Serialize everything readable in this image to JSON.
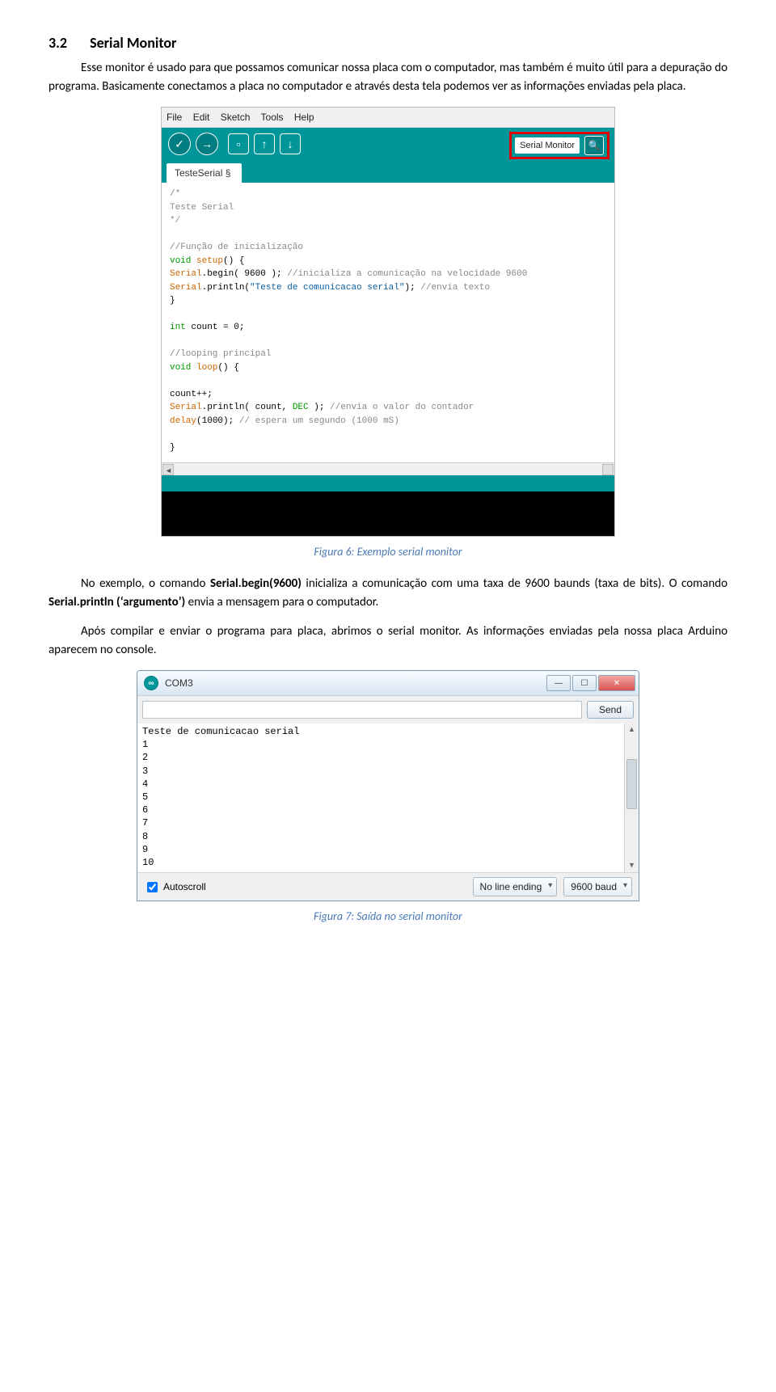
{
  "doc": {
    "heading_num": "3.2",
    "heading_title": "Serial Monitor",
    "p1": "Esse monitor é usado para que possamos comunicar nossa placa com o computador, mas também é muito útil para a depuração do programa. Basicamente conectamos a placa no computador e através desta tela podemos ver as informações enviadas pela placa.",
    "caption1": "Figura 6: Exemplo serial monitor",
    "p2_pre": "No exemplo, o comando ",
    "p2_b1": "Serial.begin(9600)",
    "p2_mid": " inicializa a comunicação com uma taxa de 9600 baunds (taxa de bits). O comando ",
    "p2_b2": "Serial.println (‘argumento’)",
    "p2_post": " envia a mensagem para o computador.",
    "p3": "Após compilar e enviar o programa para placa, abrimos o serial monitor. As informações enviadas pela nossa placa Arduino aparecem no console.",
    "caption2": "Figura 7: Saída no serial monitor"
  },
  "ide": {
    "menu": {
      "file": "File",
      "edit": "Edit",
      "sketch": "Sketch",
      "tools": "Tools",
      "help": "Help"
    },
    "serial_label": "Serial Monitor",
    "tab_name": "TesteSerial §",
    "check_glyph": "✓",
    "arrow_glyph": "→",
    "new_glyph": "▫",
    "up_glyph": "↑",
    "down_glyph": "↓",
    "scroll_left": "◄",
    "scroll_right": "►"
  },
  "code": {
    "l1": "/*",
    "l2": "  Teste Serial",
    "l3": "*/",
    "l4": "",
    "l5a": "//Função de inicialização",
    "l6a": "void",
    "l6b": " setup",
    "l6c": "() {",
    "l7a": "  Serial",
    "l7b": ".begin( 9600 );",
    "l7c": " //inicializa a comunicação na velocidade 9600",
    "l8a": "  Serial",
    "l8b": ".println(",
    "l8c": "\"Teste de comunicacao serial\"",
    "l8d": ");",
    "l8e": " //envia texto",
    "l9": "}",
    "l10": "",
    "l11a": "int",
    "l11b": " count = 0;",
    "l12": "",
    "l13": "//looping principal",
    "l14a": "void",
    "l14b": " loop",
    "l14c": "() {",
    "l15": "",
    "l16": "  count++;",
    "l17a": "  Serial",
    "l17b": ".println( count, ",
    "l17c": "DEC",
    "l17d": " );",
    "l17e": " //envia o valor do contador",
    "l18a": "  delay",
    "l18b": "(1000);",
    "l18c": "            // espera um segundo (1000 mS)",
    "l19": "",
    "l20": "}"
  },
  "serial": {
    "title": "COM3",
    "send_btn": "Send",
    "output": "Teste de comunicacao serial\n1\n2\n3\n4\n5\n6\n7\n8\n9\n10",
    "autoscroll": "Autoscroll",
    "line_ending": "No line ending",
    "baud": "9600 baud",
    "min_glyph": "—",
    "max_glyph": "☐",
    "close_glyph": "✕",
    "up_arrow": "▲",
    "down_arrow": "▼",
    "app_glyph": "∞"
  }
}
